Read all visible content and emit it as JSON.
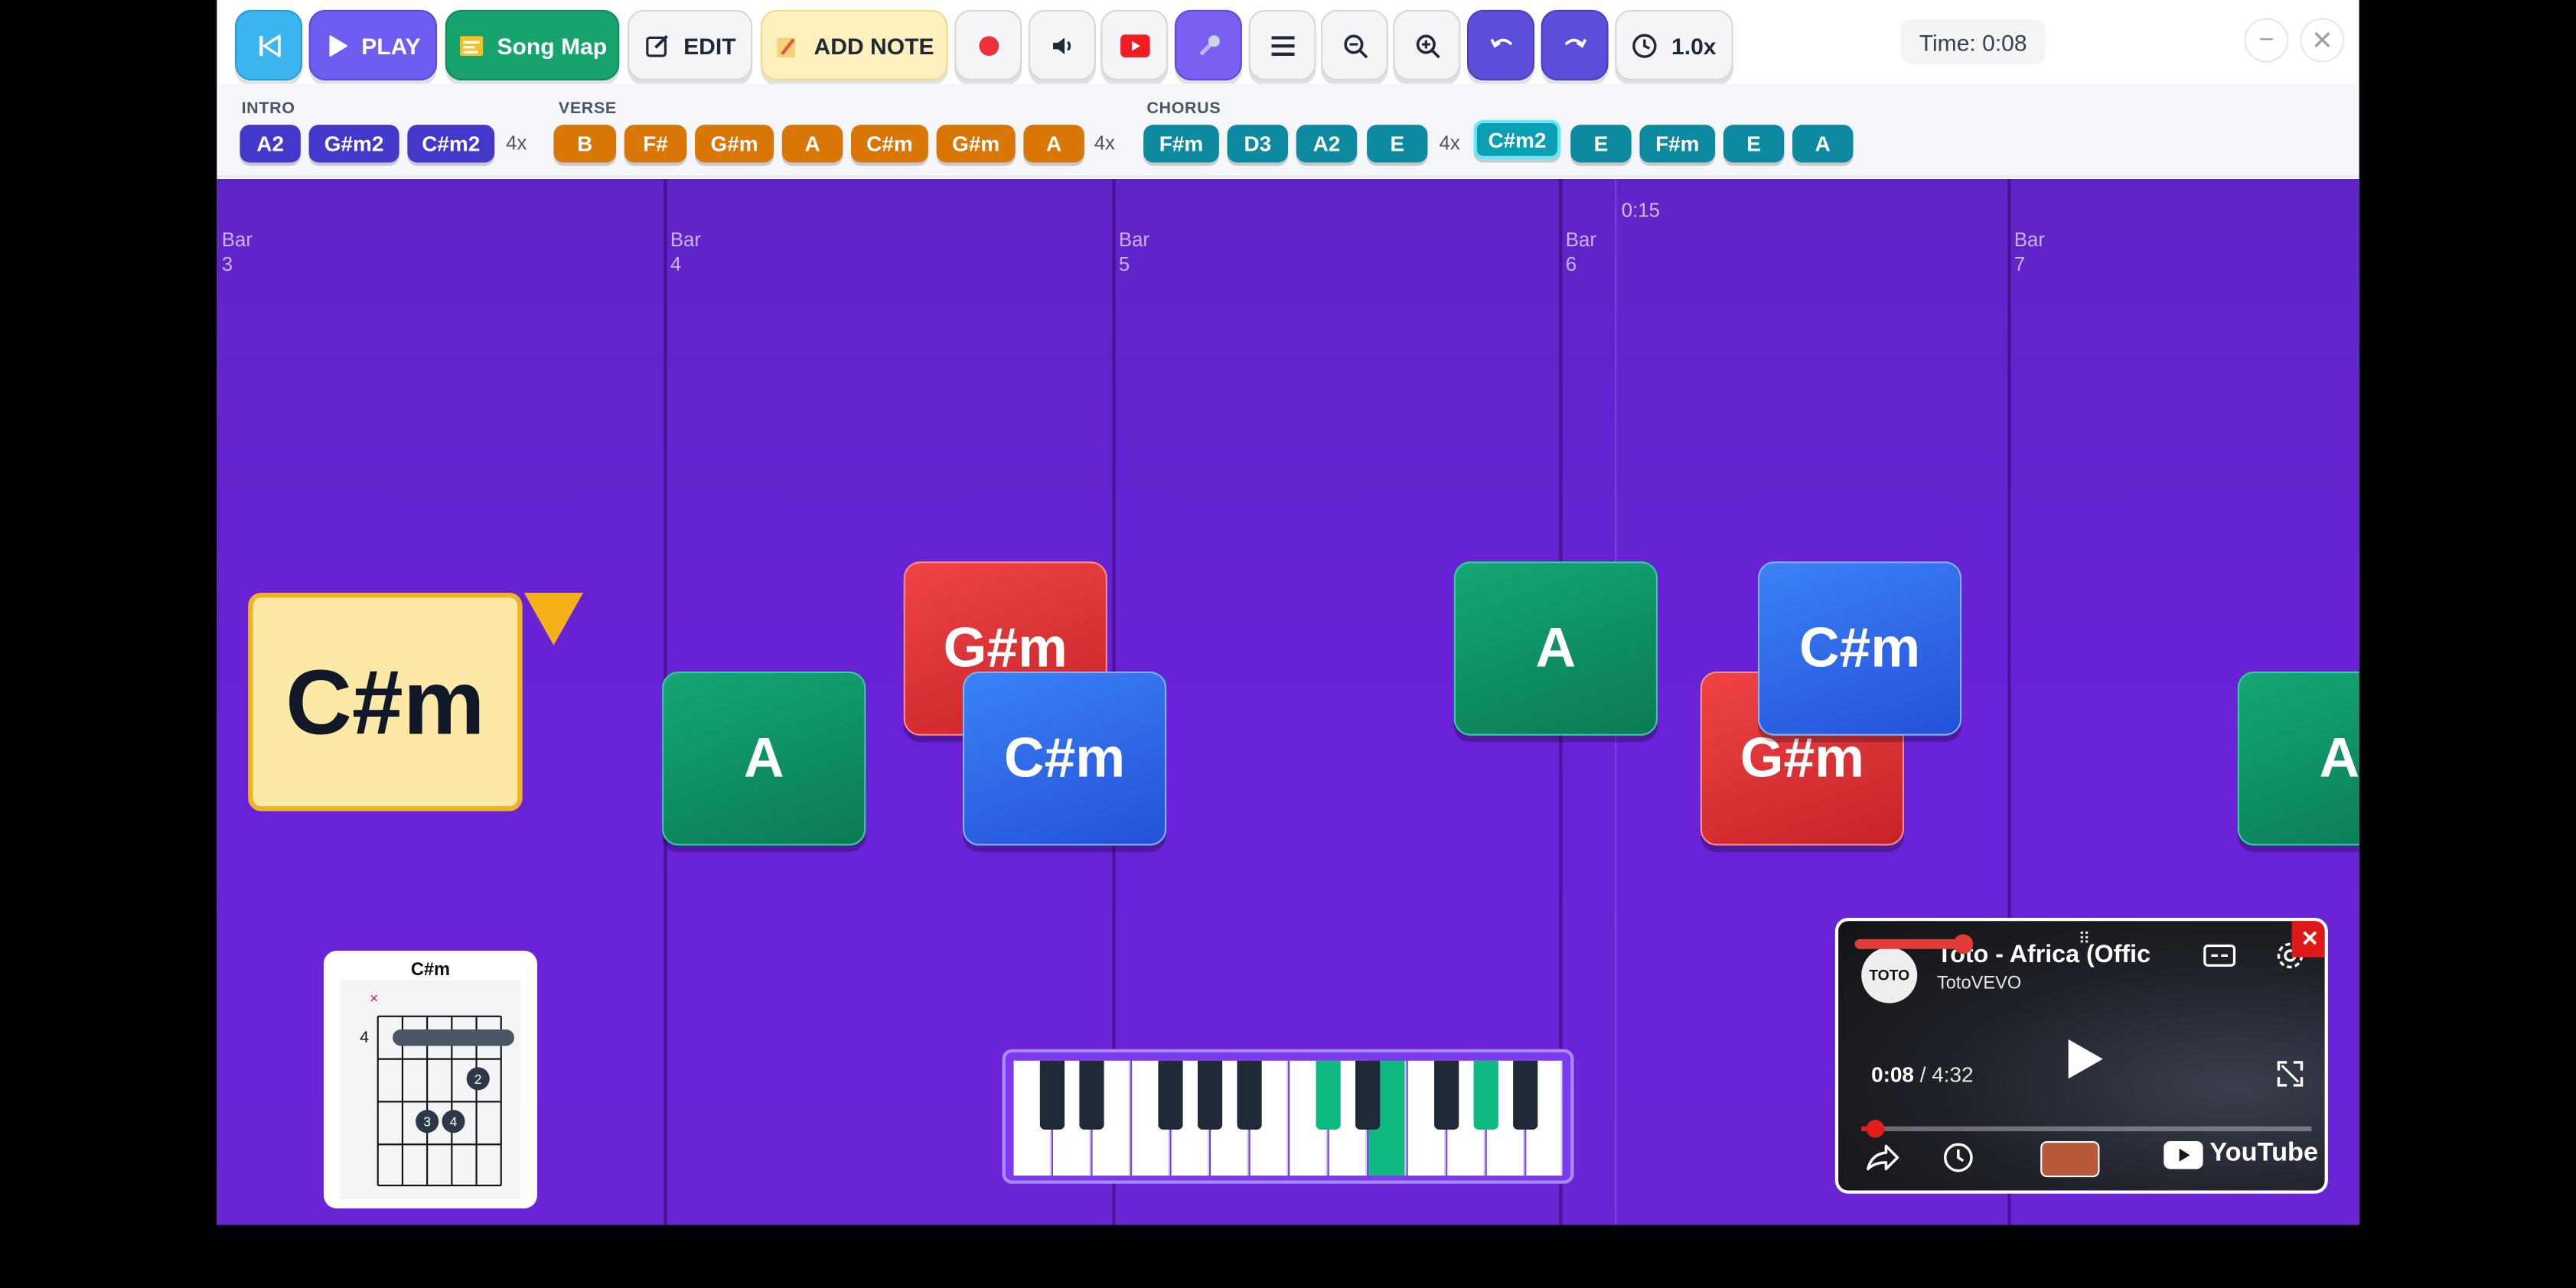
{
  "toolbar": {
    "play_label": "PLAY",
    "songmap_label": "Song Map",
    "edit_label": "EDIT",
    "addnote_label": "ADD NOTE",
    "speed_label": "1.0x",
    "time_label": "Time: 0:08"
  },
  "window": {
    "minimize": "−",
    "close": "✕"
  },
  "songmap": {
    "sections": [
      {
        "title": "INTRO",
        "chords": [
          "A2",
          "G#m2",
          "C#m2"
        ],
        "repeat": "4x"
      },
      {
        "title": "VERSE",
        "chords": [
          "B",
          "F#",
          "G#m",
          "A",
          "C#m",
          "G#m",
          "A"
        ],
        "repeat": "4x"
      },
      {
        "title": "CHORUS",
        "chords": [
          "F#m",
          "D3",
          "A2",
          "E"
        ],
        "repeat": "4x",
        "extra_chords": [
          "C#m2",
          "E",
          "F#m",
          "E",
          "A"
        ]
      }
    ],
    "colors": {
      "intro": "#4338ca",
      "verse": "#d97706",
      "chorus": "#0e8aa0",
      "chorus_active": "#0a9fb3"
    }
  },
  "timeline": {
    "bars": [
      {
        "word": "Bar",
        "num": "3"
      },
      {
        "word": "Bar",
        "num": "4"
      },
      {
        "word": "Bar",
        "num": "5"
      },
      {
        "word": "Bar",
        "num": "6"
      },
      {
        "word": "Bar",
        "num": "7"
      }
    ],
    "time_marker": "0:15",
    "current_chord": "C#m",
    "blocks": [
      "A",
      "G#m",
      "C#m",
      "A",
      "G#m",
      "C#m",
      "A"
    ]
  },
  "chord_diagram": {
    "name": "C#m",
    "fret_number": "4",
    "muted_marker": "×",
    "fingers": [
      "2",
      "3",
      "4"
    ]
  },
  "youtube": {
    "title": "Toto - Africa (Offic",
    "channel": "TotoVEVO",
    "logo_text": "TOTO",
    "current_time": "0:08",
    "duration": "/ 4:32",
    "brand": "YouTube",
    "close": "✕",
    "progress_fraction": 0.03,
    "volume_fraction": 1.0
  },
  "keyboard": {
    "highlighted_black_keys": [
      6,
      8
    ],
    "highlighted_white_keys": [
      9
    ]
  },
  "icons": [
    "skip-back-icon",
    "play-icon",
    "song-map-icon",
    "edit-icon",
    "note-icon",
    "record-icon",
    "volume-icon",
    "youtube-icon",
    "microphone-icon",
    "menu-icon",
    "zoom-out-icon",
    "zoom-in-icon",
    "undo-icon",
    "redo-icon",
    "clock-icon"
  ]
}
